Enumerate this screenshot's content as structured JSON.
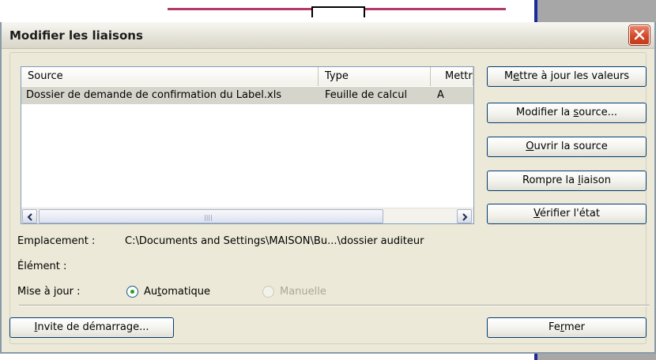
{
  "dialog": {
    "title": "Modifier les liaisons"
  },
  "list": {
    "columns": [
      "Source",
      "Type",
      "Mettr"
    ],
    "rows": [
      [
        "Dossier de demande de confirmation du Label.xls",
        "Feuille de calcul",
        "A"
      ]
    ]
  },
  "buttons": {
    "update_pre": "M",
    "update_ul": "e",
    "update_post": "ttre à jour les valeurs",
    "change_pre": "Modifier la ",
    "change_ul": "s",
    "change_post": "ource...",
    "open_pre": "",
    "open_ul": "O",
    "open_post": "uvrir la source",
    "break_pre": "Rompre la ",
    "break_ul": "l",
    "break_post": "iaison",
    "check_pre": "",
    "check_ul": "V",
    "check_post": "érifier l'état",
    "startup_pre": "",
    "startup_ul": "I",
    "startup_post": "nvite de démarrage...",
    "close_pre": "Fe",
    "close_ul": "r",
    "close_post": "mer"
  },
  "info": {
    "location_label": "Emplacement :",
    "location_value": "C:\\Documents and Settings\\MAISON\\Bu...\\dossier auditeur",
    "item_label": "Élément :",
    "update_label": "Mise à jour :",
    "auto_pre": "Au",
    "auto_ul": "t",
    "auto_post": "omatique",
    "manual_label": "Manuelle"
  },
  "colors": {
    "accent_border": "#003c74",
    "selection": "#d6d5cc",
    "dialog_bg": "#ece9d8",
    "close_red": "#d24a28"
  }
}
